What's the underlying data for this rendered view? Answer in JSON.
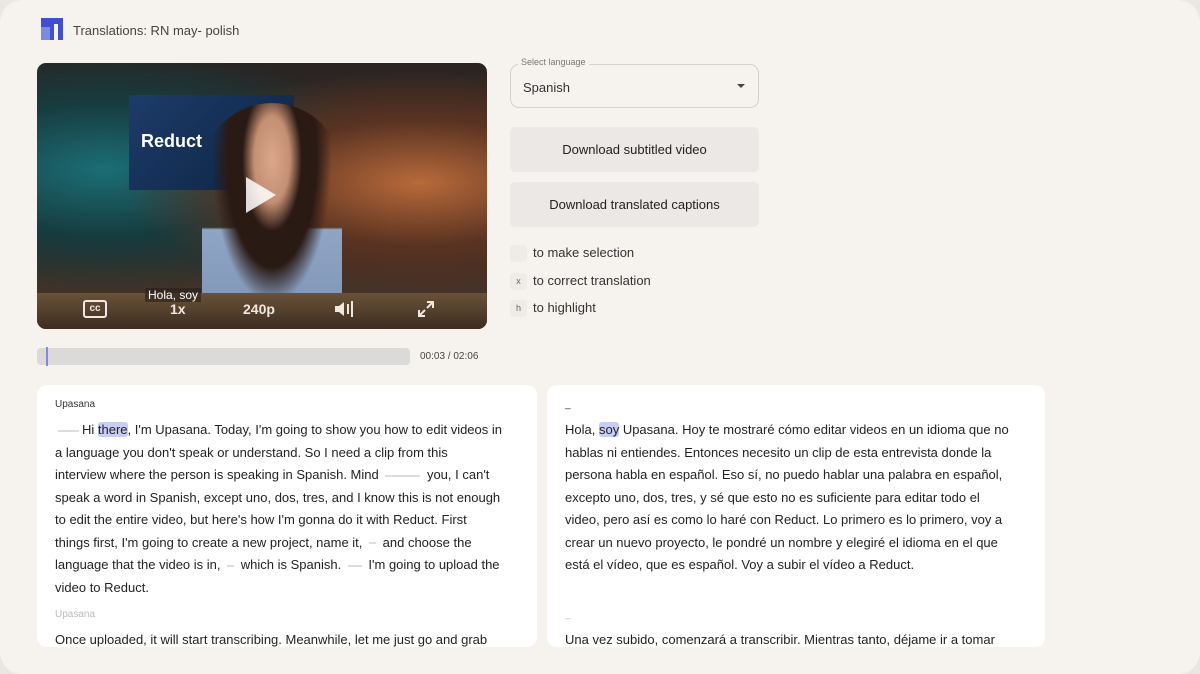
{
  "header": {
    "title": "Translations: RN may- polish",
    "brand_colors": [
      "#3f4fd0",
      "#7b8ce0"
    ]
  },
  "video": {
    "screen_text": "Reduct",
    "subtitle": "Hola, soy",
    "cc": "cc",
    "speed": "1x",
    "quality": "240p",
    "progress_fraction": 0.024,
    "time": "00:03 / 02:06"
  },
  "language_select": {
    "label": "Select language",
    "value": "Spanish"
  },
  "buttons": {
    "download_video": "Download subtitled video",
    "download_captions": "Download translated captions"
  },
  "shortcuts": [
    {
      "key": "",
      "label": "to make selection"
    },
    {
      "key": "x",
      "label": "to correct translation"
    },
    {
      "key": "h",
      "label": "to highlight"
    }
  ],
  "source": {
    "blocks": [
      {
        "speaker": "Upasana",
        "lines": [
          [
            {
              "gap": 3
            },
            {
              "t": "Hi "
            },
            {
              "t": "there",
              "hl": true
            },
            {
              "t": ", I'm Upasana. Today, I'm going to show you how to edit videos in"
            }
          ],
          [
            {
              "t": "a language you don't speak or understand. So I need a clip from this"
            }
          ],
          [
            {
              "t": "interview where the person is speaking in Spanish. Mind "
            },
            {
              "gap": 5
            },
            {
              "t": " you, I can't"
            }
          ],
          [
            {
              "t": "speak a word in Spanish, except uno, dos, tres, and I know this is not enough"
            }
          ],
          [
            {
              "t": "to edit the entire video, but here's how I'm gonna do it with Reduct. First"
            }
          ],
          [
            {
              "t": "things first, I'm going to create a new project, name it, "
            },
            {
              "gap": 1
            },
            {
              "t": " and choose the"
            }
          ],
          [
            {
              "t": "language that the video is in, "
            },
            {
              "gap": 1
            },
            {
              "t": " which is Spanish. "
            },
            {
              "gap": 2
            },
            {
              "t": " I'm going to upload the"
            }
          ],
          [
            {
              "t": "video to Reduct."
            }
          ]
        ]
      },
      {
        "speaker": "Upasana",
        "dim": true,
        "lines": [
          [
            {
              "t": "Once uploaded, it will start transcribing. Meanwhile, let me just go and grab"
            }
          ]
        ]
      }
    ]
  },
  "translation": {
    "blocks": [
      {
        "speaker": "_",
        "lines": [
          [
            {
              "t": "Hola, "
            },
            {
              "t": "soy",
              "hl": true
            },
            {
              "t": " Upasana. Hoy te mostraré cómo editar videos en un idioma que no"
            }
          ],
          [
            {
              "t": "hablas ni entiendes. Entonces necesito un clip de esta entrevista donde la"
            }
          ],
          [
            {
              "t": "persona habla en español. Eso sí, no puedo hablar una palabra en español,"
            }
          ],
          [
            {
              "t": "excepto uno, dos, tres, y sé que esto no es suficiente para editar todo el"
            }
          ],
          [
            {
              "t": "video, pero así es como lo haré con Reduct. Lo primero es lo primero, voy a"
            }
          ],
          [
            {
              "t": "crear un nuevo proyecto, le pondré un nombre y elegiré el idioma en el que"
            }
          ],
          [
            {
              "t": "está el vídeo, que es español. Voy a subir el vídeo a Reduct."
            }
          ],
          [
            {
              "t": ""
            }
          ]
        ]
      },
      {
        "speaker": "_",
        "dim": true,
        "lines": [
          [
            {
              "t": "Una vez subido, comenzará a transcribir. Mientras tanto, déjame ir a tomar"
            }
          ]
        ]
      }
    ]
  }
}
